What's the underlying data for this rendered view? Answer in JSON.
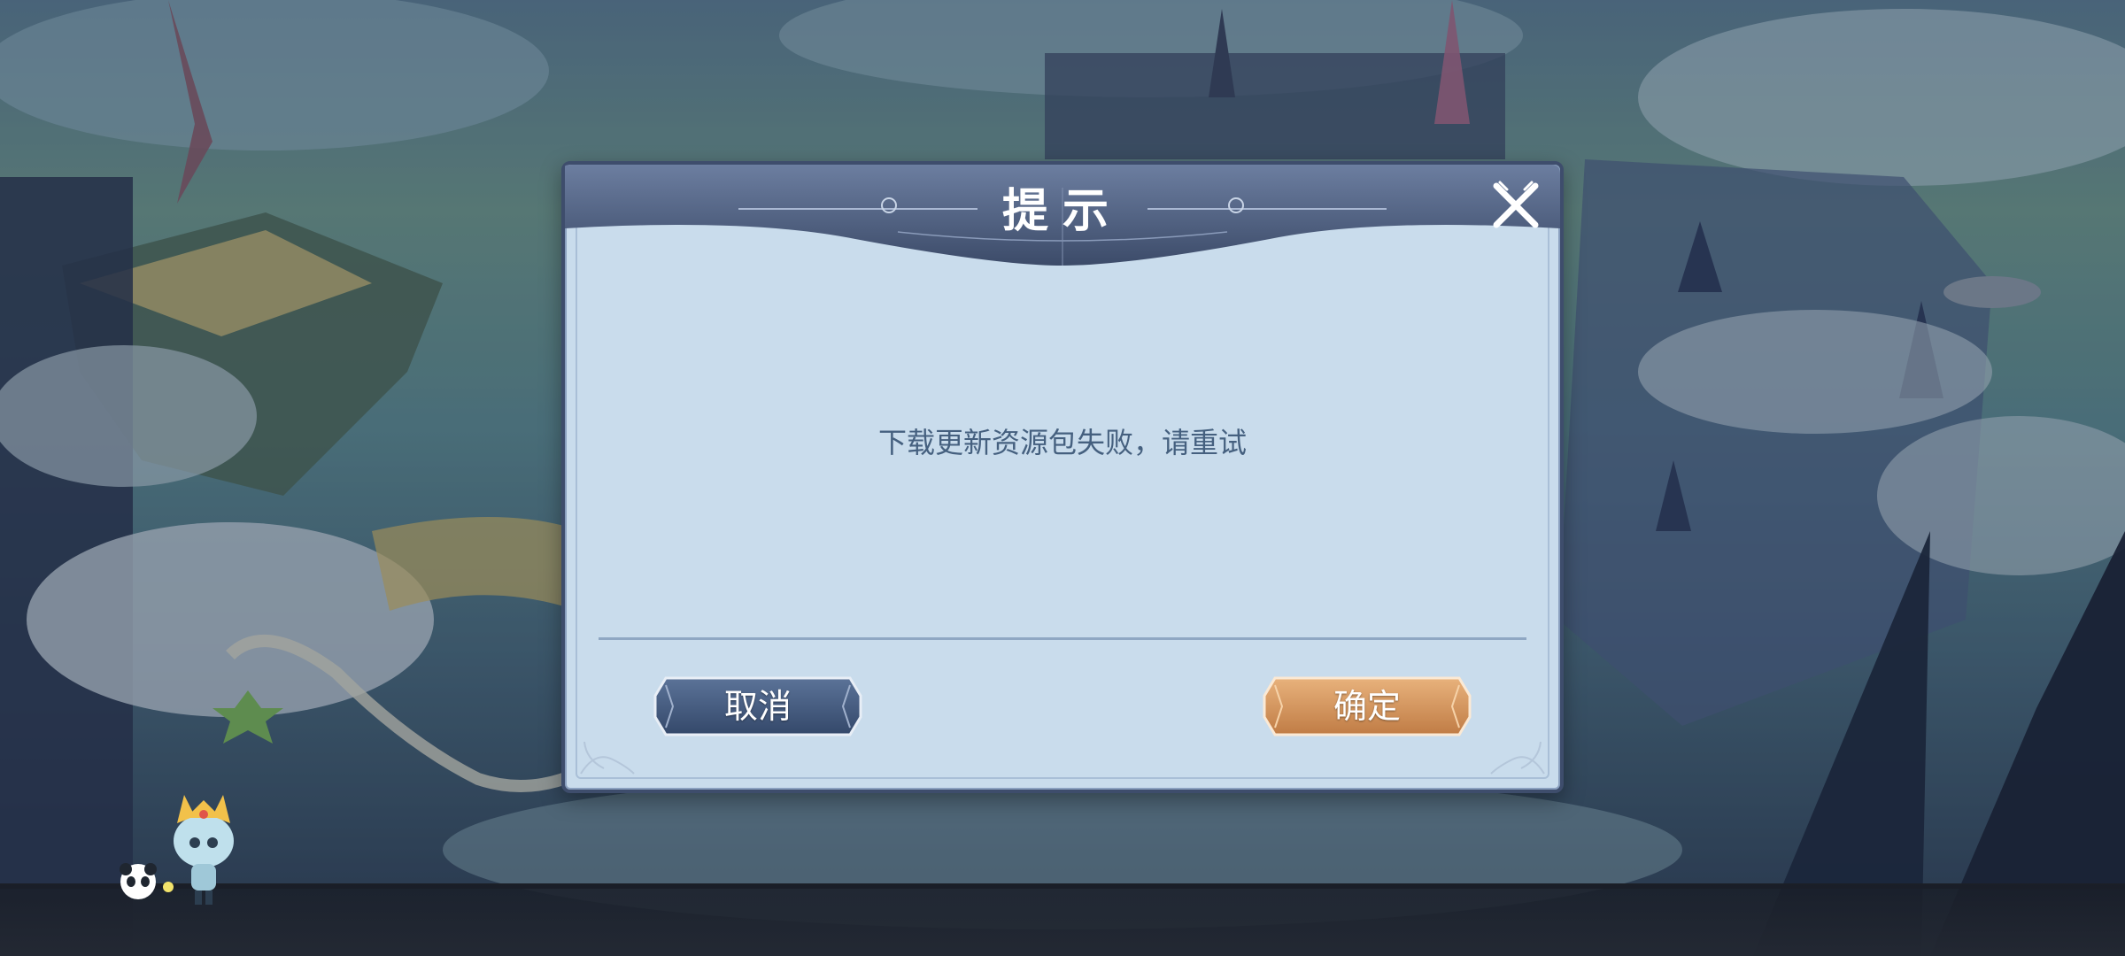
{
  "dialog": {
    "title": "提示",
    "message": "下载更新资源包失败，请重试",
    "cancel_label": "取消",
    "confirm_label": "确定"
  },
  "icons": {
    "close": "close-icon",
    "mascot": "mascot-icon"
  },
  "colors": {
    "dialog_bg": "#c9dcec",
    "header": "#4a5a7a",
    "message_text": "#45607f",
    "cancel_button": "#3f5678",
    "confirm_button": "#d39a67"
  }
}
